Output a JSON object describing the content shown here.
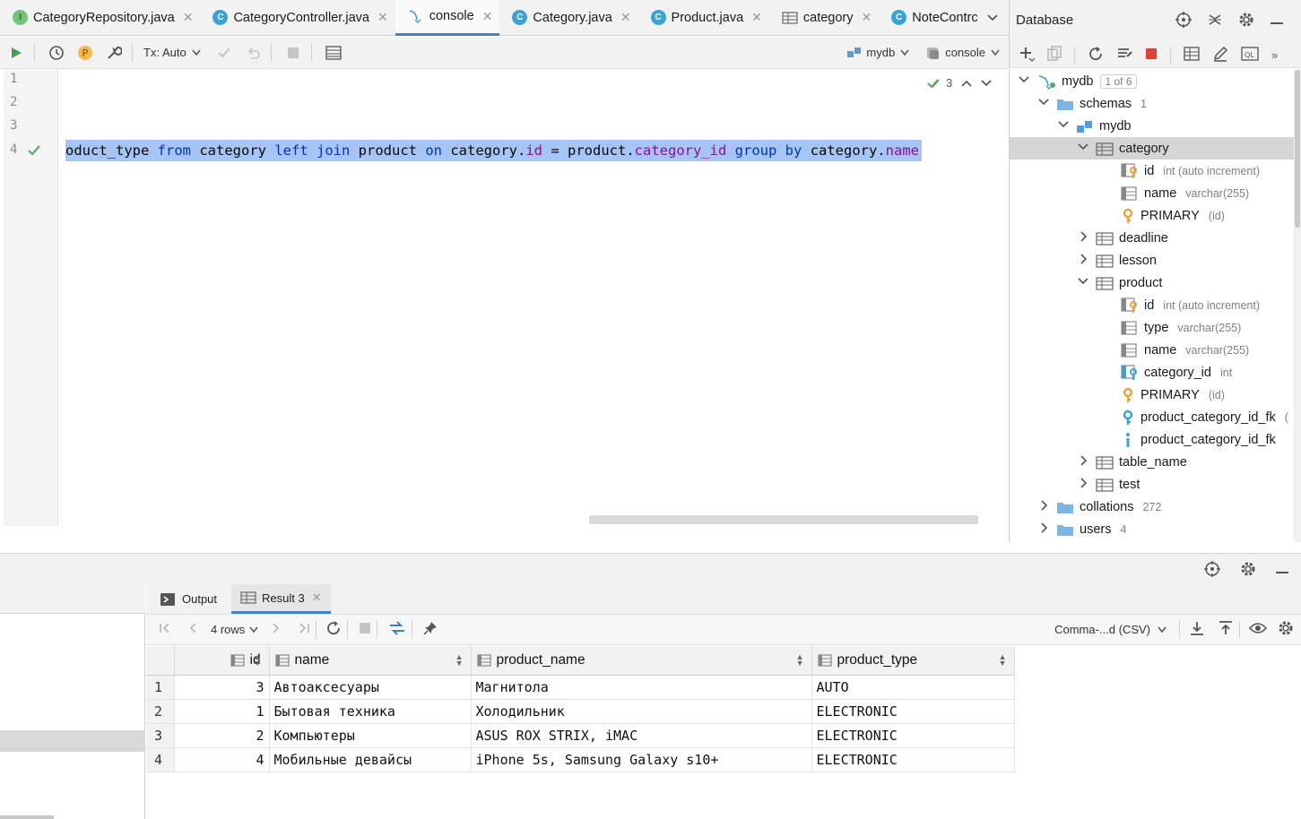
{
  "tabs": [
    {
      "label": "CategoryRepository.java",
      "icon": "interface-icon",
      "active": false
    },
    {
      "label": "CategoryController.java",
      "icon": "class-icon",
      "active": false
    },
    {
      "label": "console",
      "icon": "console-icon",
      "active": true
    },
    {
      "label": "Category.java",
      "icon": "class-icon",
      "active": false
    },
    {
      "label": "Product.java",
      "icon": "class-icon",
      "active": false
    },
    {
      "label": "category",
      "icon": "table-icon",
      "active": false
    },
    {
      "label": "NoteContrc",
      "icon": "class-icon",
      "active": false
    }
  ],
  "toolbar": {
    "tx_label": "Tx: Auto",
    "datasource": "mydb",
    "session": "console"
  },
  "editor": {
    "line_numbers": [
      "1",
      "2",
      "3",
      "4"
    ],
    "sql_tokens": [
      {
        "t": "oduct_type ",
        "c": "txt"
      },
      {
        "t": "from ",
        "c": "kw"
      },
      {
        "t": "category ",
        "c": "txt"
      },
      {
        "t": "left ",
        "c": "kw"
      },
      {
        "t": "join ",
        "c": "kw"
      },
      {
        "t": "product ",
        "c": "txt"
      },
      {
        "t": "on ",
        "c": "kw"
      },
      {
        "t": "category.",
        "c": "txt"
      },
      {
        "t": "id",
        "c": "fld"
      },
      {
        "t": " = ",
        "c": "txt"
      },
      {
        "t": "product.",
        "c": "txt"
      },
      {
        "t": "category_id",
        "c": "fld"
      },
      {
        "t": " ",
        "c": "txt"
      },
      {
        "t": "group ",
        "c": "kw"
      },
      {
        "t": "by ",
        "c": "kw"
      },
      {
        "t": "category.",
        "c": "txt"
      },
      {
        "t": "name",
        "c": "fld"
      }
    ],
    "check_count": "3"
  },
  "database": {
    "title": "Database",
    "tree": [
      {
        "label": "mydb",
        "sub": "1 of 6",
        "icon": "datasource-icon",
        "chev": "down",
        "lvl": 0
      },
      {
        "label": "schemas",
        "sub": "1",
        "icon": "folder-icon",
        "chev": "down",
        "lvl": 1
      },
      {
        "label": "mydb",
        "sub": "",
        "icon": "schema-icon",
        "chev": "down",
        "lvl": 2
      },
      {
        "label": "category",
        "sub": "",
        "icon": "table-icon",
        "chev": "down",
        "lvl": 3,
        "selected": true
      },
      {
        "label": "id",
        "sub": "int (auto increment)",
        "icon": "pk-column-icon",
        "chev": "",
        "lvl": 4
      },
      {
        "label": "name",
        "sub": "varchar(255)",
        "icon": "column-icon",
        "chev": "",
        "lvl": 4
      },
      {
        "label": "PRIMARY",
        "sub": "(id)",
        "icon": "key-icon",
        "chev": "",
        "lvl": 4
      },
      {
        "label": "deadline",
        "sub": "",
        "icon": "table-icon",
        "chev": "right",
        "lvl": 3
      },
      {
        "label": "lesson",
        "sub": "",
        "icon": "table-icon",
        "chev": "right",
        "lvl": 3
      },
      {
        "label": "product",
        "sub": "",
        "icon": "table-icon",
        "chev": "down",
        "lvl": 3
      },
      {
        "label": "id",
        "sub": "int (auto increment)",
        "icon": "pk-column-icon",
        "chev": "",
        "lvl": 4
      },
      {
        "label": "type",
        "sub": "varchar(255)",
        "icon": "column-icon",
        "chev": "",
        "lvl": 4
      },
      {
        "label": "name",
        "sub": "varchar(255)",
        "icon": "column-icon",
        "chev": "",
        "lvl": 4
      },
      {
        "label": "category_id",
        "sub": "int",
        "icon": "fk-column-icon",
        "chev": "",
        "lvl": 4
      },
      {
        "label": "PRIMARY",
        "sub": "(id)",
        "icon": "key-icon",
        "chev": "",
        "lvl": 4
      },
      {
        "label": "product_category_id_fk",
        "sub": "(",
        "icon": "fk-icon",
        "chev": "",
        "lvl": 4
      },
      {
        "label": "product_category_id_fk",
        "sub": "",
        "icon": "index-icon",
        "chev": "",
        "lvl": 4
      },
      {
        "label": "table_name",
        "sub": "",
        "icon": "table-icon",
        "chev": "right",
        "lvl": 3
      },
      {
        "label": "test",
        "sub": "",
        "icon": "table-icon",
        "chev": "right",
        "lvl": 3
      },
      {
        "label": "collations",
        "sub": "272",
        "icon": "folder-icon",
        "chev": "right",
        "lvl": 1
      },
      {
        "label": "users",
        "sub": "4",
        "icon": "folder-icon",
        "chev": "right",
        "lvl": 1
      }
    ]
  },
  "services": {
    "tabs": [
      {
        "label": "Output",
        "icon": "output-icon",
        "active": false
      },
      {
        "label": "Result 3",
        "icon": "table-icon",
        "active": true
      }
    ],
    "rows_label": "4 rows",
    "export_format": "Comma-...d (CSV)"
  },
  "result": {
    "columns": [
      "id",
      "name",
      "product_name",
      "product_type"
    ],
    "rows": [
      {
        "rn": "1",
        "id": "3",
        "name": "Автоаксесуары",
        "product_name": "Магнитола",
        "product_type": "AUTO"
      },
      {
        "rn": "2",
        "id": "1",
        "name": "Бытовая техника",
        "product_name": "Холодильник",
        "product_type": "ELECTRONIC"
      },
      {
        "rn": "3",
        "id": "2",
        "name": "Компьютеры",
        "product_name": "ASUS ROX STRIX, iMAC",
        "product_type": "ELECTRONIC"
      },
      {
        "rn": "4",
        "id": "4",
        "name": "Мобильные девайсы",
        "product_name": "iPhone 5s, Samsung Galaxy s10+",
        "product_type": "ELECTRONIC"
      }
    ]
  }
}
